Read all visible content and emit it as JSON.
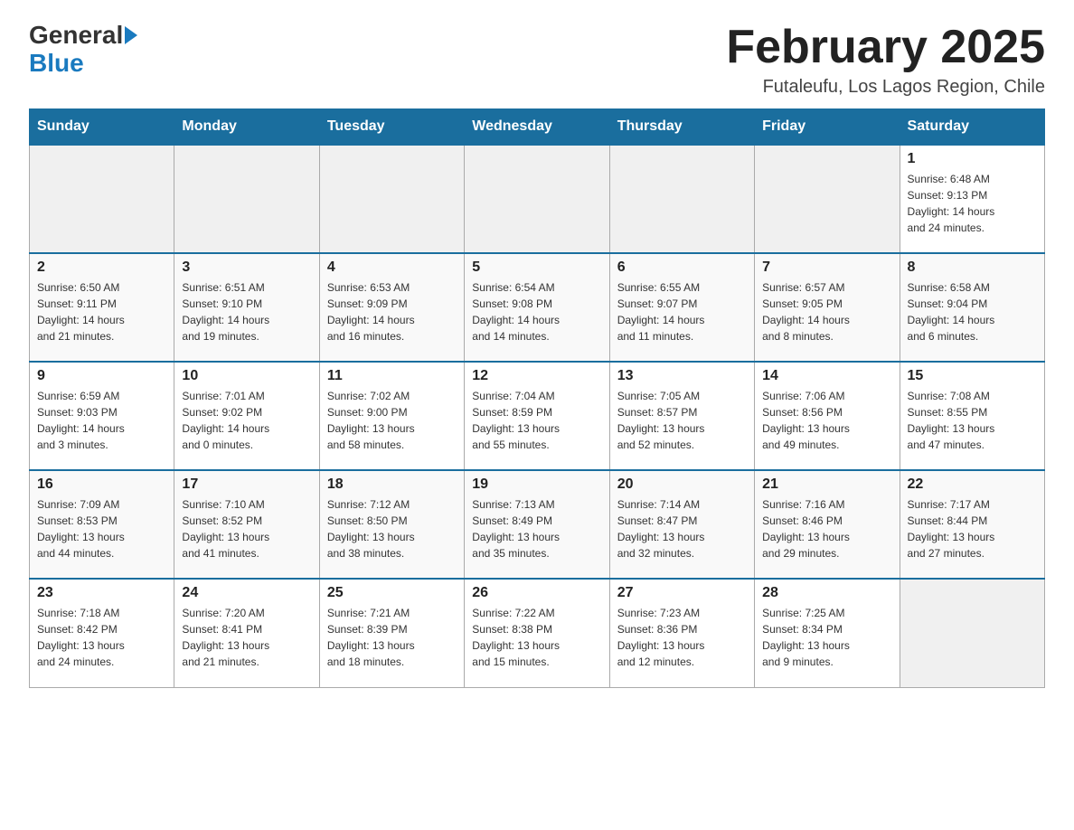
{
  "header": {
    "logo_line1": "General",
    "logo_line2": "Blue",
    "month_title": "February 2025",
    "location": "Futaleufu, Los Lagos Region, Chile"
  },
  "days_of_week": [
    "Sunday",
    "Monday",
    "Tuesday",
    "Wednesday",
    "Thursday",
    "Friday",
    "Saturday"
  ],
  "weeks": [
    [
      {
        "day": "",
        "info": ""
      },
      {
        "day": "",
        "info": ""
      },
      {
        "day": "",
        "info": ""
      },
      {
        "day": "",
        "info": ""
      },
      {
        "day": "",
        "info": ""
      },
      {
        "day": "",
        "info": ""
      },
      {
        "day": "1",
        "info": "Sunrise: 6:48 AM\nSunset: 9:13 PM\nDaylight: 14 hours\nand 24 minutes."
      }
    ],
    [
      {
        "day": "2",
        "info": "Sunrise: 6:50 AM\nSunset: 9:11 PM\nDaylight: 14 hours\nand 21 minutes."
      },
      {
        "day": "3",
        "info": "Sunrise: 6:51 AM\nSunset: 9:10 PM\nDaylight: 14 hours\nand 19 minutes."
      },
      {
        "day": "4",
        "info": "Sunrise: 6:53 AM\nSunset: 9:09 PM\nDaylight: 14 hours\nand 16 minutes."
      },
      {
        "day": "5",
        "info": "Sunrise: 6:54 AM\nSunset: 9:08 PM\nDaylight: 14 hours\nand 14 minutes."
      },
      {
        "day": "6",
        "info": "Sunrise: 6:55 AM\nSunset: 9:07 PM\nDaylight: 14 hours\nand 11 minutes."
      },
      {
        "day": "7",
        "info": "Sunrise: 6:57 AM\nSunset: 9:05 PM\nDaylight: 14 hours\nand 8 minutes."
      },
      {
        "day": "8",
        "info": "Sunrise: 6:58 AM\nSunset: 9:04 PM\nDaylight: 14 hours\nand 6 minutes."
      }
    ],
    [
      {
        "day": "9",
        "info": "Sunrise: 6:59 AM\nSunset: 9:03 PM\nDaylight: 14 hours\nand 3 minutes."
      },
      {
        "day": "10",
        "info": "Sunrise: 7:01 AM\nSunset: 9:02 PM\nDaylight: 14 hours\nand 0 minutes."
      },
      {
        "day": "11",
        "info": "Sunrise: 7:02 AM\nSunset: 9:00 PM\nDaylight: 13 hours\nand 58 minutes."
      },
      {
        "day": "12",
        "info": "Sunrise: 7:04 AM\nSunset: 8:59 PM\nDaylight: 13 hours\nand 55 minutes."
      },
      {
        "day": "13",
        "info": "Sunrise: 7:05 AM\nSunset: 8:57 PM\nDaylight: 13 hours\nand 52 minutes."
      },
      {
        "day": "14",
        "info": "Sunrise: 7:06 AM\nSunset: 8:56 PM\nDaylight: 13 hours\nand 49 minutes."
      },
      {
        "day": "15",
        "info": "Sunrise: 7:08 AM\nSunset: 8:55 PM\nDaylight: 13 hours\nand 47 minutes."
      }
    ],
    [
      {
        "day": "16",
        "info": "Sunrise: 7:09 AM\nSunset: 8:53 PM\nDaylight: 13 hours\nand 44 minutes."
      },
      {
        "day": "17",
        "info": "Sunrise: 7:10 AM\nSunset: 8:52 PM\nDaylight: 13 hours\nand 41 minutes."
      },
      {
        "day": "18",
        "info": "Sunrise: 7:12 AM\nSunset: 8:50 PM\nDaylight: 13 hours\nand 38 minutes."
      },
      {
        "day": "19",
        "info": "Sunrise: 7:13 AM\nSunset: 8:49 PM\nDaylight: 13 hours\nand 35 minutes."
      },
      {
        "day": "20",
        "info": "Sunrise: 7:14 AM\nSunset: 8:47 PM\nDaylight: 13 hours\nand 32 minutes."
      },
      {
        "day": "21",
        "info": "Sunrise: 7:16 AM\nSunset: 8:46 PM\nDaylight: 13 hours\nand 29 minutes."
      },
      {
        "day": "22",
        "info": "Sunrise: 7:17 AM\nSunset: 8:44 PM\nDaylight: 13 hours\nand 27 minutes."
      }
    ],
    [
      {
        "day": "23",
        "info": "Sunrise: 7:18 AM\nSunset: 8:42 PM\nDaylight: 13 hours\nand 24 minutes."
      },
      {
        "day": "24",
        "info": "Sunrise: 7:20 AM\nSunset: 8:41 PM\nDaylight: 13 hours\nand 21 minutes."
      },
      {
        "day": "25",
        "info": "Sunrise: 7:21 AM\nSunset: 8:39 PM\nDaylight: 13 hours\nand 18 minutes."
      },
      {
        "day": "26",
        "info": "Sunrise: 7:22 AM\nSunset: 8:38 PM\nDaylight: 13 hours\nand 15 minutes."
      },
      {
        "day": "27",
        "info": "Sunrise: 7:23 AM\nSunset: 8:36 PM\nDaylight: 13 hours\nand 12 minutes."
      },
      {
        "day": "28",
        "info": "Sunrise: 7:25 AM\nSunset: 8:34 PM\nDaylight: 13 hours\nand 9 minutes."
      },
      {
        "day": "",
        "info": ""
      }
    ]
  ]
}
